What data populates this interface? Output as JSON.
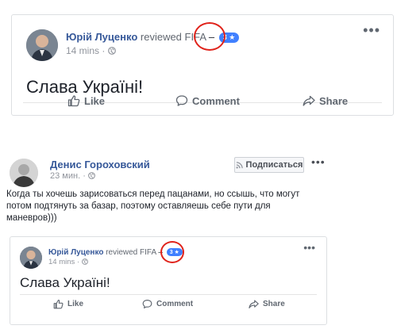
{
  "top_post": {
    "author": "Юрій Луценко",
    "action": "reviewed",
    "target": "FIFA",
    "rating": "3 ★",
    "time": "14 mins",
    "privacy_icon": "globe-icon",
    "text": "Слава Україні!",
    "more": "•••",
    "buttons": {
      "like": "Like",
      "comment": "Comment",
      "share": "Share"
    }
  },
  "ru_post": {
    "author": "Денис Гороховский",
    "time": "23 мин.",
    "privacy_icon": "globe-icon",
    "subscribe": "Подписаться",
    "more": "•••",
    "text": "Когда ты хочешь зарисоваться перед пацанами, но ссышь, что могут потом подтянуть за базар, поэтому оставляешь себе пути для маневров)))"
  },
  "inner_post": {
    "author": "Юрій Луценко",
    "action": "reviewed",
    "target": "FIFA",
    "rating": "3 ★",
    "time": "14 mins",
    "text": "Слава Україні!",
    "more": "•••",
    "buttons": {
      "like": "Like",
      "comment": "Comment",
      "share": "Share"
    }
  },
  "colors": {
    "link": "#365899",
    "annotation_circle": "#e0231b",
    "rating_badge": "#4080ff"
  }
}
